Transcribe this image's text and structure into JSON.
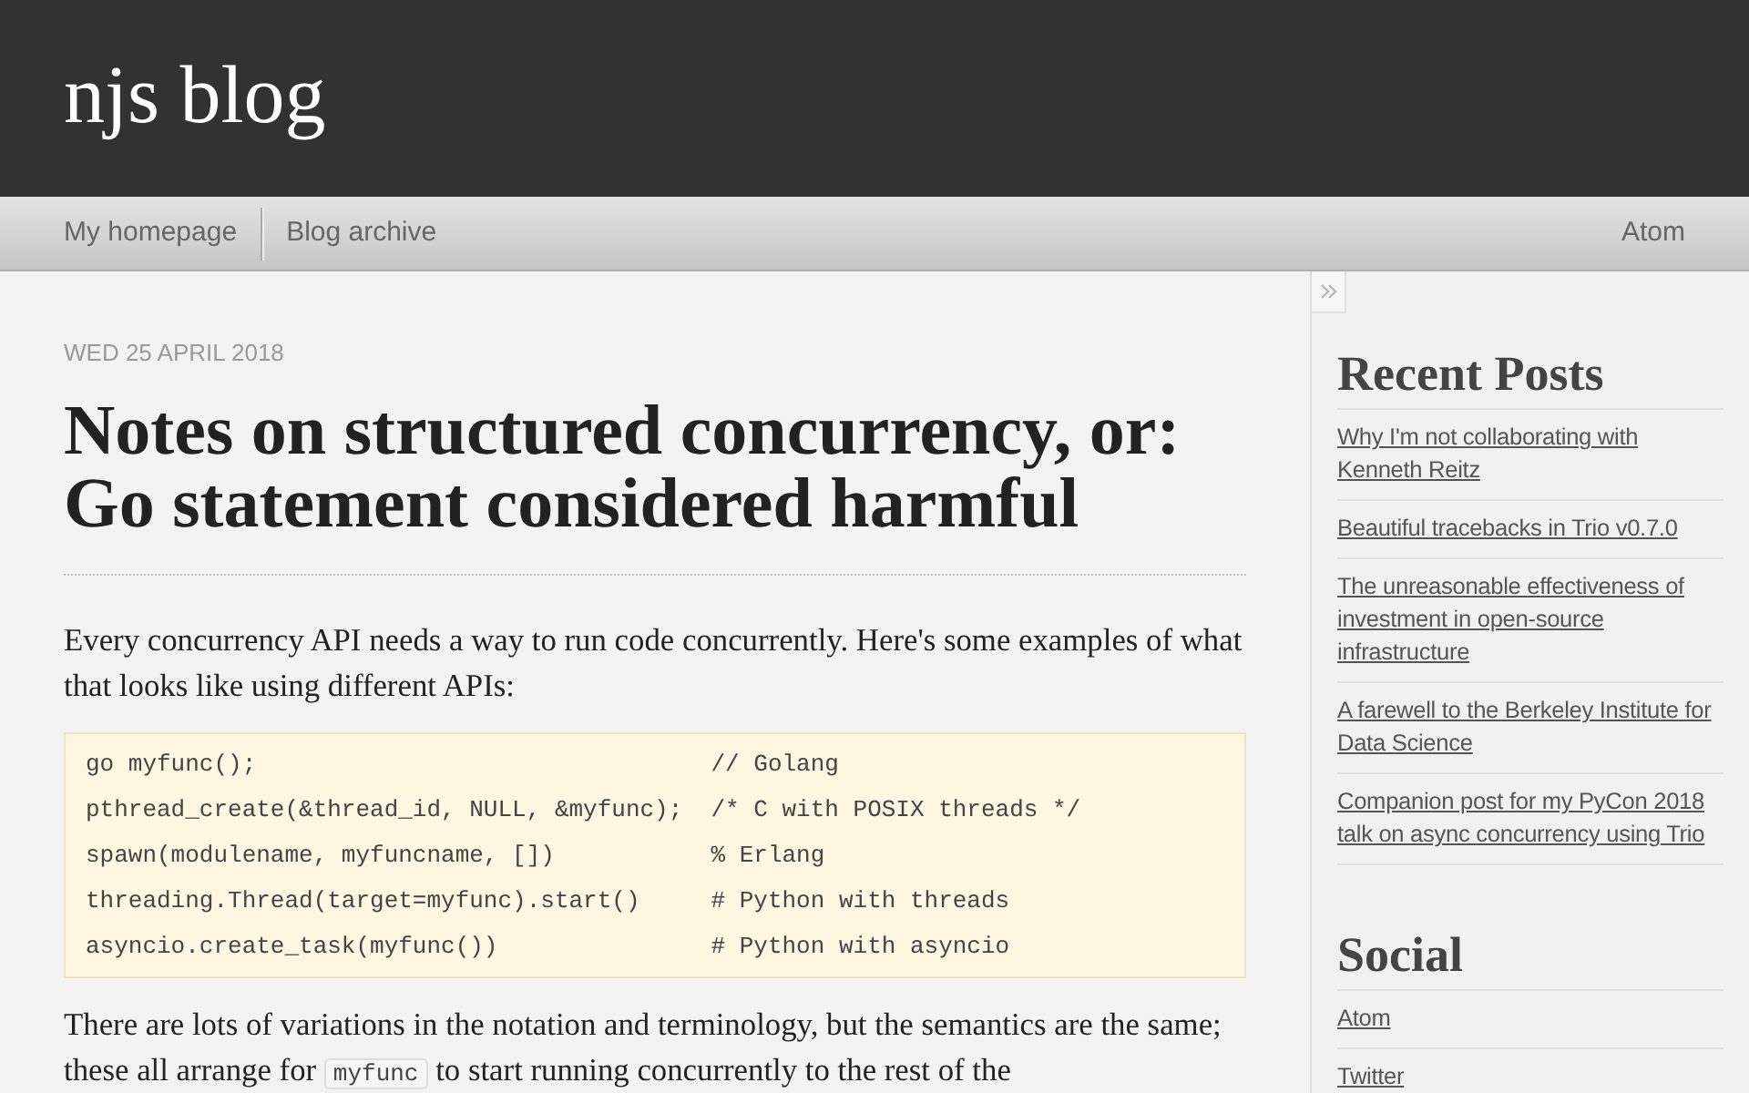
{
  "header": {
    "title": "njs blog"
  },
  "nav": {
    "items": [
      {
        "label": "My homepage"
      },
      {
        "label": "Blog archive"
      }
    ],
    "right_items": [
      {
        "label": "Atom"
      }
    ]
  },
  "article": {
    "date": "WED 25 APRIL 2018",
    "title": "Notes on structured concurrency, or: Go statement considered harmful",
    "blocks": [
      {
        "kind": "paragraph",
        "segments": [
          {
            "kind": "text",
            "text": "Every concurrency API needs a way to run code concurrently. Here's some examples of what that looks like using different APIs:"
          }
        ]
      },
      {
        "kind": "code_block",
        "lines": [
          {
            "code": "go myfunc();",
            "comment": "// Golang"
          },
          {
            "code": "pthread_create(&thread_id, NULL, &myfunc);",
            "comment": "/* C with POSIX threads */"
          },
          {
            "code": "spawn(modulename, myfuncname, [])",
            "comment": "% Erlang"
          },
          {
            "code": "threading.Thread(target=myfunc).start()",
            "comment": "# Python with threads"
          },
          {
            "code": "asyncio.create_task(myfunc())",
            "comment": "# Python with asyncio"
          }
        ]
      },
      {
        "kind": "paragraph",
        "segments": [
          {
            "kind": "text",
            "text": "There are lots of variations in the notation and terminology, but the semantics are the same; these all arrange for "
          },
          {
            "kind": "code",
            "text": "myfunc"
          },
          {
            "kind": "text",
            "text": " to start running concurrently to the rest of the"
          }
        ]
      }
    ]
  },
  "sidebar": {
    "sections": [
      {
        "heading": "Recent Posts",
        "links": [
          "Why I'm not collaborating with Kenneth Reitz",
          "Beautiful tracebacks in Trio v0.7.0",
          "The unreasonable effectiveness of investment in open-source infrastructure",
          "A farewell to the Berkeley Institute for Data Science",
          "Companion post for my PyCon 2018 talk on async concurrency using Trio"
        ]
      },
      {
        "heading": "Social",
        "links": [
          "Atom",
          "Twitter"
        ]
      }
    ]
  }
}
